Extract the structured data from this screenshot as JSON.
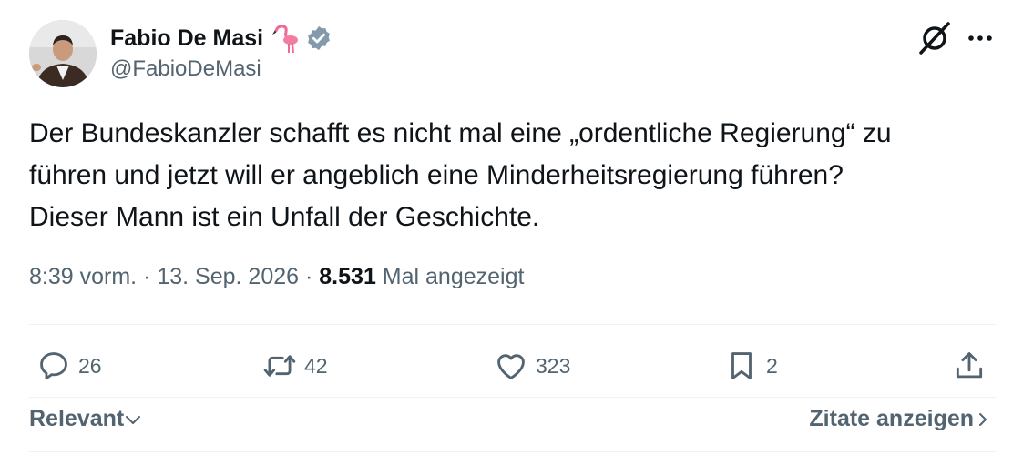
{
  "author": {
    "name": "Fabio De Masi",
    "handle": "@FabioDeMasi",
    "emoji_icon": "flamingo-icon",
    "verified_icon": "verified-badge-icon"
  },
  "tweet": {
    "lines": [
      "Der Bundeskanzler schafft es nicht mal eine „ordentliche Regierung“ zu",
      "führen und jetzt will er angeblich eine Minderheitsregierung führen?",
      "Dieser Mann ist ein Unfall der Geschichte."
    ],
    "time": "8:39 vorm.",
    "sep": "·",
    "date": "13. Sep. 2026",
    "views": "8.531",
    "views_label": "Mal angezeigt"
  },
  "actions": {
    "replies": "26",
    "reposts": "42",
    "likes": "323",
    "bookmarks": "2"
  },
  "footer": {
    "sort_label": "Relevant",
    "quotes_label": "Zitate anzeigen"
  },
  "colors": {
    "text": "#0f1419",
    "secondary": "#536471",
    "verified_badge": "#829aab",
    "divider": "#eff3f4"
  }
}
